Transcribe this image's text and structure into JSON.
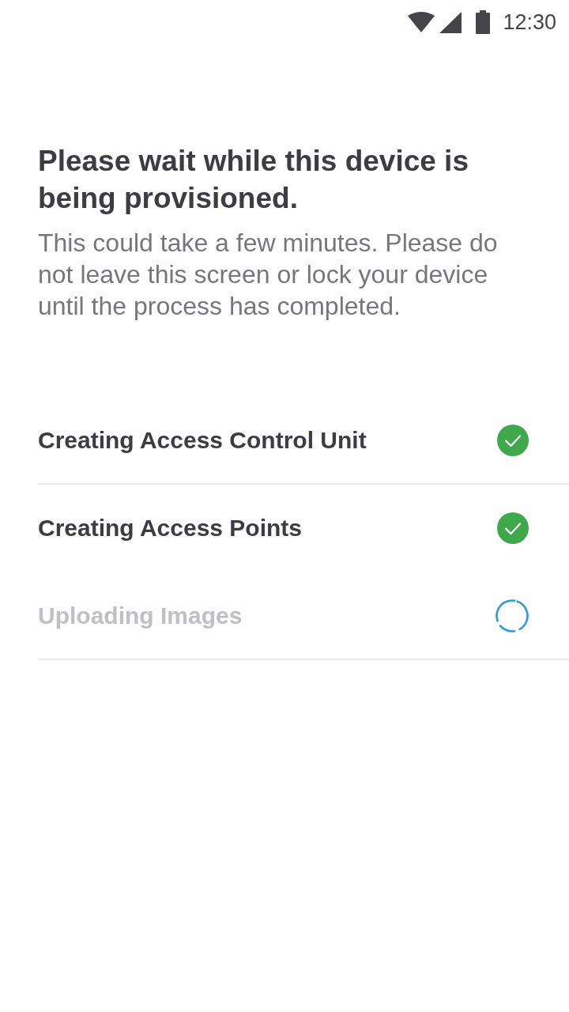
{
  "status_bar": {
    "time": "12:30"
  },
  "header": {
    "title": "Please wait while this device is being provisioned.",
    "message": "This could take a few minutes. Please do not leave this screen or lock your device until the process has completed."
  },
  "steps": [
    {
      "label": "Creating Access Control Unit",
      "kind": "done",
      "divider": true
    },
    {
      "label": "Creating Access Points",
      "kind": "done",
      "divider": false
    },
    {
      "label": "Uploading Images",
      "kind": "loading",
      "divider": true
    }
  ]
}
